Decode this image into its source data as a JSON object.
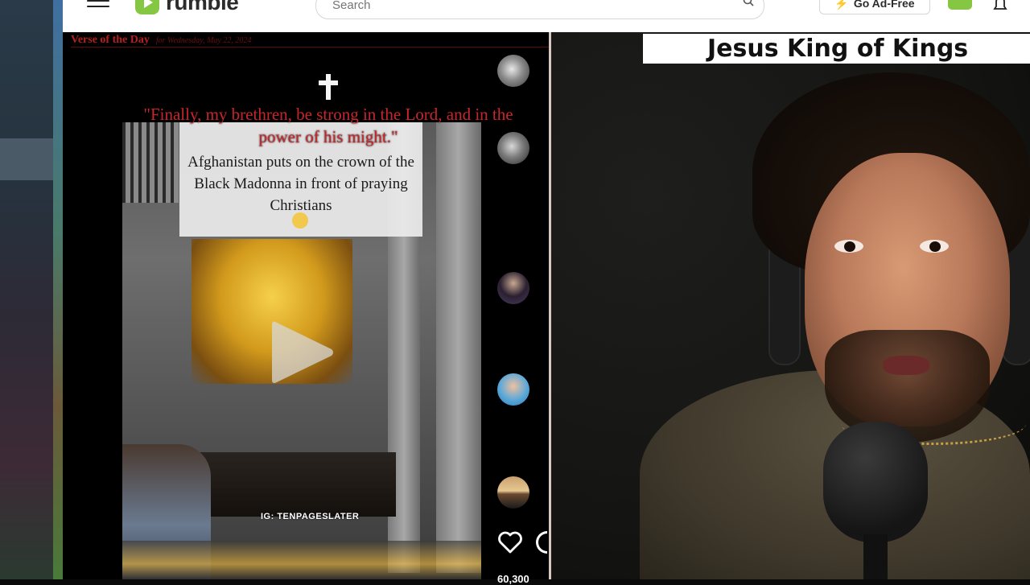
{
  "header": {
    "logo_text": "rumble",
    "search_placeholder": "Search",
    "ad_free_label": "Go Ad-Free"
  },
  "video": {
    "verse_banner": "Verse of the Day",
    "verse_date": "for Wednesday, May 22, 2024",
    "verse_quote": "\"Finally, my brethren, be strong in the Lord, and in the power of his might.\"",
    "caption": "Afghanistan puts on the crown of the Black Madonna in front of praying Christians",
    "watermark": "IG: TENPAGESLATER",
    "like_count": "60,300"
  },
  "stream": {
    "title_banner": "Jesus King of Kings"
  },
  "colors": {
    "rumble_green": "#85c742",
    "verse_red": "#c8262a"
  }
}
